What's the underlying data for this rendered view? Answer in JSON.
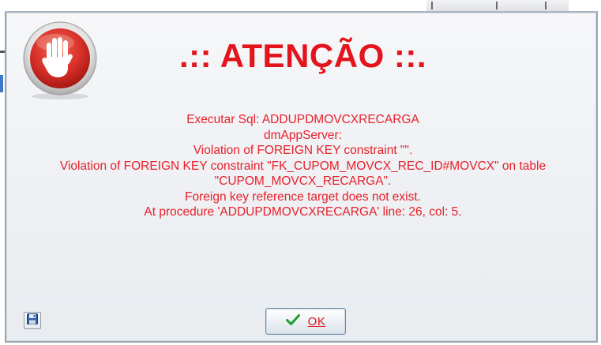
{
  "dialog": {
    "title": ".:: ATENÇÃO ::.",
    "message_lines": [
      "Executar Sql: ADDUPDMOVCXRECARGA",
      "dmAppServer:",
      "Violation of FOREIGN KEY constraint \"\".",
      "Violation of FOREIGN KEY constraint \"FK_CUPOM_MOVCX_REC_ID#MOVCX\" on table",
      "\"CUPOM_MOVCX_RECARGA\".",
      "Foreign key reference target does not exist.",
      "At procedure 'ADDUPDMOVCXRECARGA' line: 26, col: 5."
    ],
    "ok_label": "OK"
  },
  "icons": {
    "stop": "stop-hand-icon",
    "save": "floppy-disk-icon",
    "ok": "checkmark-icon"
  },
  "colors": {
    "title": "#e3141b",
    "message": "#e8202a",
    "dialog_background": "#eef0f3",
    "stop_icon": "#d8312a",
    "checkmark": "#1e9e2a"
  }
}
